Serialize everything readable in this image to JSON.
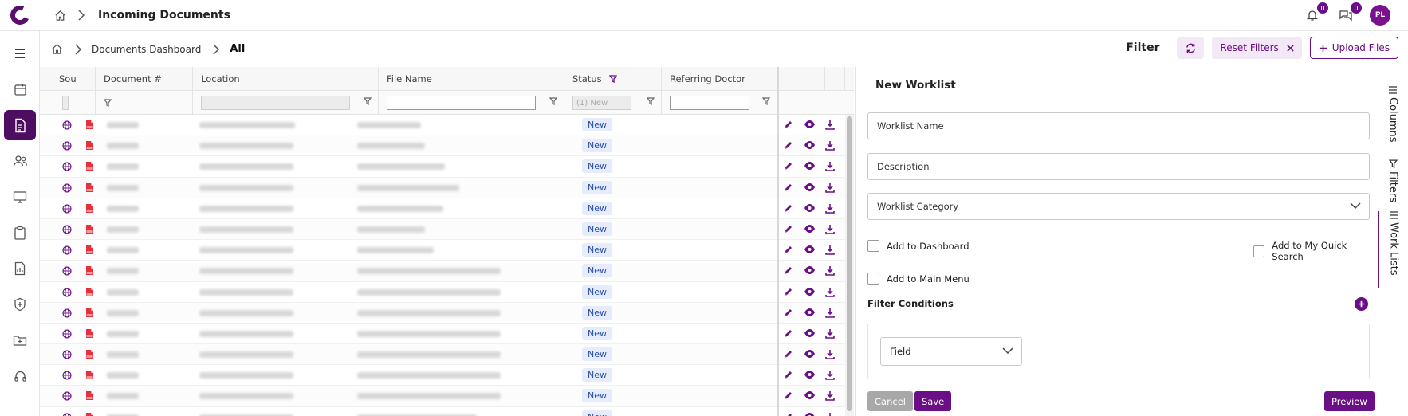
{
  "topbar": {
    "title": "Incoming Documents",
    "notifications_count": "0",
    "messages_count": "0",
    "avatar_initials": "PL"
  },
  "subheader": {
    "crumb": "Documents Dashboard",
    "current": "All",
    "filter_label": "Filter",
    "reset_label": "Reset Filters",
    "upload_label": "Upload Files"
  },
  "grid": {
    "columns": [
      "Sou",
      "Document #",
      "Location",
      "File Name",
      "Status",
      "Referring Doctor"
    ],
    "status_filter_placeholder": "(1) New",
    "rows": [
      {
        "status": "New"
      },
      {
        "status": "New"
      },
      {
        "status": "New"
      },
      {
        "status": "New"
      },
      {
        "status": "New"
      },
      {
        "status": "New"
      },
      {
        "status": "New"
      },
      {
        "status": "New"
      },
      {
        "status": "New"
      },
      {
        "status": "New"
      },
      {
        "status": "New"
      },
      {
        "status": "New"
      },
      {
        "status": "New"
      },
      {
        "status": "New"
      },
      {
        "status": "New"
      }
    ]
  },
  "panel": {
    "title": "New Worklist",
    "worklist_name": "Worklist Name",
    "description": "Description",
    "category": "Worklist Category",
    "add_dashboard": "Add to Dashboard",
    "add_quick_search": "Add to My Quick Search",
    "add_main_menu": "Add to Main Menu",
    "filter_conditions": "Filter Conditions",
    "field_select": "Field",
    "cancel": "Cancel",
    "save": "Save",
    "preview": "Preview"
  },
  "side_tabs": {
    "columns": "Columns",
    "filters": "Filters",
    "work_lists": "Work Lists"
  },
  "colors": {
    "accent": "#6a0f86",
    "sidebar_active": "#4d0d60",
    "badge_bg": "#e6ecfb"
  }
}
